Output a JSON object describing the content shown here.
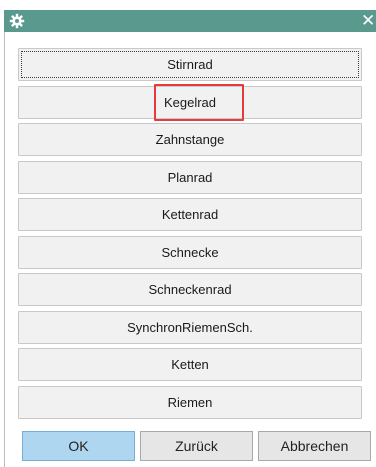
{
  "window": {
    "icon": "gear-icon",
    "close_icon": "close-icon",
    "close_glyph": "✕"
  },
  "options": [
    {
      "label": "Stirnrad",
      "focused": true
    },
    {
      "label": "Kegelrad",
      "highlighted": true
    },
    {
      "label": "Zahnstange"
    },
    {
      "label": "Planrad"
    },
    {
      "label": "Kettenrad"
    },
    {
      "label": "Schnecke"
    },
    {
      "label": "Schneckenrad"
    },
    {
      "label": "SynchronRiemenSch."
    },
    {
      "label": "Ketten"
    },
    {
      "label": "Riemen"
    }
  ],
  "footer": {
    "ok_label": "OK",
    "back_label": "Zurück",
    "cancel_label": "Abbrechen"
  },
  "colors": {
    "titlebar": "#5a9a8e",
    "highlight": "#e8393b",
    "primary_button": "#aed6f1"
  }
}
